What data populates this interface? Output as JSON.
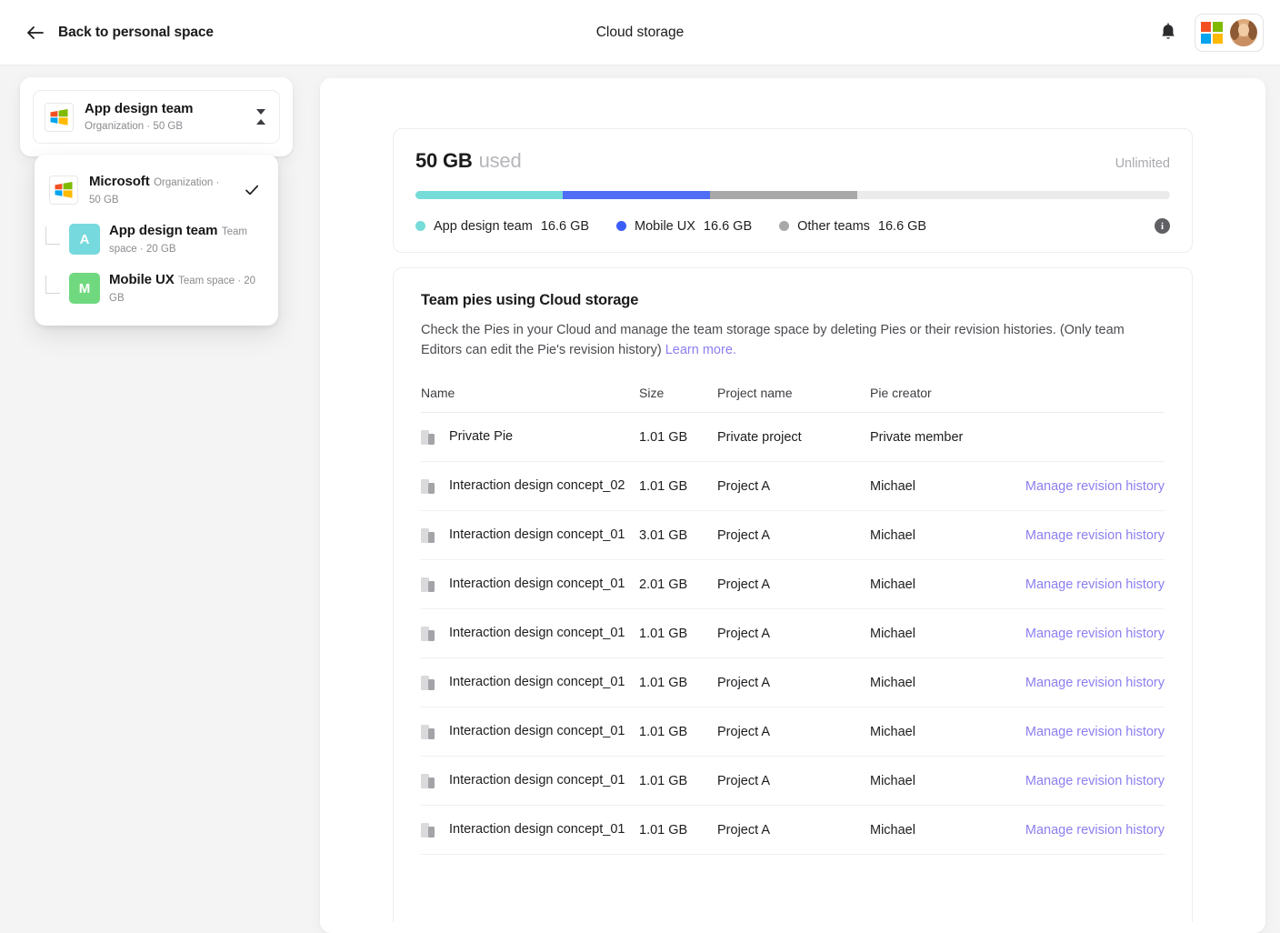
{
  "topbar": {
    "back_label": "Back to personal space",
    "title": "Cloud storage",
    "back_icon": "arrow-left-icon",
    "bell_icon": "bell-icon",
    "avatar_icon": "user-avatar",
    "ms_logo_icon": "microsoft-logo-icon"
  },
  "selector": {
    "title": "App design team",
    "subtitle": "Organization · 50 GB",
    "chevron_icon": "chevron-updown-icon"
  },
  "dropdown": {
    "org": {
      "title": "Microsoft",
      "subtitle": "Organization · 50 GB",
      "selected": true,
      "check_icon": "check-icon"
    },
    "teams": [
      {
        "initial": "A",
        "title": "App design team",
        "subtitle": "Team space · 20 GB",
        "color": "#76d9dd"
      },
      {
        "initial": "M",
        "title": "Mobile UX",
        "subtitle": "Team space · 20 GB",
        "color": "#70d97f"
      }
    ]
  },
  "storage": {
    "used_value": "50 GB",
    "used_word": "used",
    "limit_label": "Unlimited",
    "info_icon": "info-icon",
    "info_glyph": "i",
    "segments": [
      {
        "label": "App design team",
        "value": "16.6 GB",
        "color": "#76dcd8",
        "percent": 19.5
      },
      {
        "label": "Mobile UX",
        "value": "16.6 GB",
        "color": "#4f6df5",
        "percent": 19.5
      },
      {
        "label": "Other teams",
        "value": "16.6 GB",
        "color": "#a8a8a8",
        "percent": 19.5
      }
    ],
    "track_color": "#ebebeb"
  },
  "pies": {
    "title": "Team pies using Cloud storage",
    "description": "Check the Pies in your Cloud and manage the team storage space by deleting Pies or their revision histories. (Only team Editors can edit the Pie's revision history)",
    "learn_more": "Learn more.",
    "columns": [
      "Name",
      "Size",
      "Project name",
      "Pie creator",
      ""
    ],
    "rows": [
      {
        "name": "Private Pie",
        "size": "1.01 GB",
        "project": "Private project",
        "creator": "Private member",
        "action": ""
      },
      {
        "name": "Interaction design concept_02",
        "size": "1.01 GB",
        "project": "Project A",
        "creator": "Michael",
        "action": "Manage revision history"
      },
      {
        "name": "Interaction design concept_01",
        "size": "3.01 GB",
        "project": "Project A",
        "creator": "Michael",
        "action": "Manage revision history"
      },
      {
        "name": "Interaction design concept_01",
        "size": "2.01 GB",
        "project": "Project A",
        "creator": "Michael",
        "action": "Manage revision history"
      },
      {
        "name": "Interaction design concept_01",
        "size": "1.01 GB",
        "project": "Project A",
        "creator": "Michael",
        "action": "Manage revision history"
      },
      {
        "name": "Interaction design concept_01",
        "size": "1.01 GB",
        "project": "Project A",
        "creator": "Michael",
        "action": "Manage revision history"
      },
      {
        "name": "Interaction design concept_01",
        "size": "1.01 GB",
        "project": "Project A",
        "creator": "Michael",
        "action": "Manage revision history"
      },
      {
        "name": "Interaction design concept_01",
        "size": "1.01 GB",
        "project": "Project A",
        "creator": "Michael",
        "action": "Manage revision history"
      },
      {
        "name": "Interaction design concept_01",
        "size": "1.01 GB",
        "project": "Project A",
        "creator": "Michael",
        "action": "Manage revision history"
      }
    ],
    "row_icon": "pie-file-icon"
  },
  "theme": {
    "accent_link": "#8b7ff0",
    "page_bg": "#f4f4f4"
  }
}
